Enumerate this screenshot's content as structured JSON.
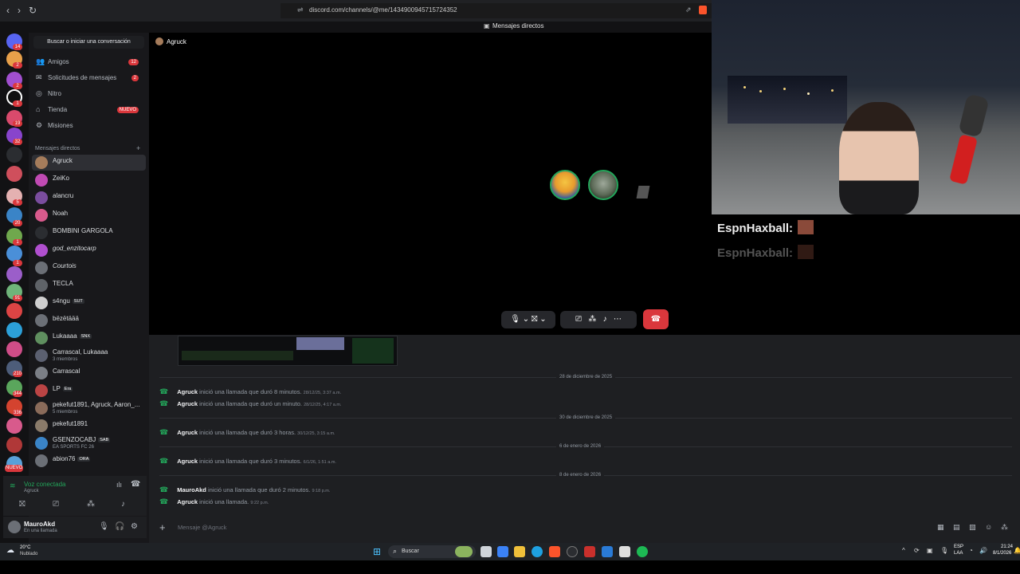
{
  "browser": {
    "url": "discord.com/channels/@me/1434900945715724352"
  },
  "window": {
    "title": "Mensajes directos"
  },
  "sidebar": {
    "search_label": "Buscar o iniciar una conversación",
    "nav": [
      {
        "label": "Amigos",
        "icon": "people-icon",
        "badge": "12"
      },
      {
        "label": "Solicitudes de mensajes",
        "icon": "mail-icon",
        "badge": "2"
      },
      {
        "label": "Nitro",
        "icon": "nitro-icon",
        "badge": ""
      },
      {
        "label": "Tienda",
        "icon": "store-icon",
        "badge": "NUEVO"
      },
      {
        "label": "Misiones",
        "icon": "quest-icon",
        "badge": ""
      }
    ],
    "dm_header": "Mensajes directos",
    "dms": [
      {
        "name": "Agruck",
        "sub": "",
        "tag": ""
      },
      {
        "name": "ZeiKo",
        "sub": "",
        "tag": ""
      },
      {
        "name": "alancru",
        "sub": "",
        "tag": ""
      },
      {
        "name": "Noah",
        "sub": "",
        "tag": ""
      },
      {
        "name": "BOMBINI GARGOLA",
        "sub": "",
        "tag": ""
      },
      {
        "name": "god_enzitocarp",
        "sub": "",
        "tag": ""
      },
      {
        "name": "Courtois",
        "sub": "",
        "tag": ""
      },
      {
        "name": "TECLA",
        "sub": "",
        "tag": ""
      },
      {
        "name": "s4ngu",
        "sub": "",
        "tag": "SUT"
      },
      {
        "name": "bëzëtäää",
        "sub": "",
        "tag": ""
      },
      {
        "name": "Lukaaaa",
        "sub": "",
        "tag": "SNX"
      },
      {
        "name": "Carrascal, Lukaaaa",
        "sub": "3 miembros",
        "tag": ""
      },
      {
        "name": "Carrascal",
        "sub": "",
        "tag": ""
      },
      {
        "name": "LP",
        "sub": "",
        "tag": "Era"
      },
      {
        "name": "pekefut1891, Agruck, Aaron_...",
        "sub": "5 miembros",
        "tag": ""
      },
      {
        "name": "pekefut1891",
        "sub": "",
        "tag": ""
      },
      {
        "name": "GSENZOCABJ",
        "sub": "EA SPORTS FC 26",
        "tag": "SAB"
      },
      {
        "name": "abion76",
        "sub": "",
        "tag": "ORA"
      }
    ],
    "server_badges": [
      "14",
      "2",
      "2",
      "1",
      "19",
      "32",
      "5",
      "20",
      "1",
      "1",
      "91",
      "210",
      "344",
      "336",
      "NUEVO"
    ]
  },
  "voice": {
    "status": "Voz conectada",
    "channel": "Agruck"
  },
  "user": {
    "name": "MauroAkd",
    "status": "En una llamada"
  },
  "call": {
    "title": "Agruck"
  },
  "chat": {
    "messages": [
      {
        "date": "28 de diciembre de 2025",
        "author": "Agruck",
        "text": "inició una llamada que duró 8 minutos.",
        "time": "28/12/25, 3:37 a.m."
      },
      {
        "date": "",
        "author": "Agruck",
        "text": "inició una llamada que duró un minuto.",
        "time": "28/12/25, 4:17 a.m."
      },
      {
        "date": "30 de diciembre de 2025",
        "author": "Agruck",
        "text": "inició una llamada que duró 3 horas.",
        "time": "30/12/25, 3:15 a.m."
      },
      {
        "date": "6 de enero de 2026",
        "author": "Agruck",
        "text": "inició una llamada que duró 3 minutos.",
        "time": "6/1/26, 1:51 a.m."
      },
      {
        "date": "8 de enero de 2026",
        "author": "MauroAkd",
        "text": "inició una llamada que duró 2 minutos.",
        "time": "9:18 p.m."
      },
      {
        "date": "",
        "author": "Agruck",
        "text": "inició una llamada.",
        "time": "9:22 p.m."
      }
    ],
    "composer_placeholder": "Mensaje @Agruck"
  },
  "stream_overlay": {
    "chat_lines": [
      "EspnHaxball:",
      "EspnHaxball:"
    ]
  },
  "taskbar": {
    "search_label": "Buscar",
    "lang": "ESP",
    "lang2": "LAA",
    "time": "21:24",
    "date": "8/1/2026",
    "weather_temp": "20°C",
    "weather_desc": "Nublado"
  },
  "colors": {
    "accent_green": "#23a55a",
    "danger_red": "#da373c",
    "background": "#1e1f22"
  }
}
